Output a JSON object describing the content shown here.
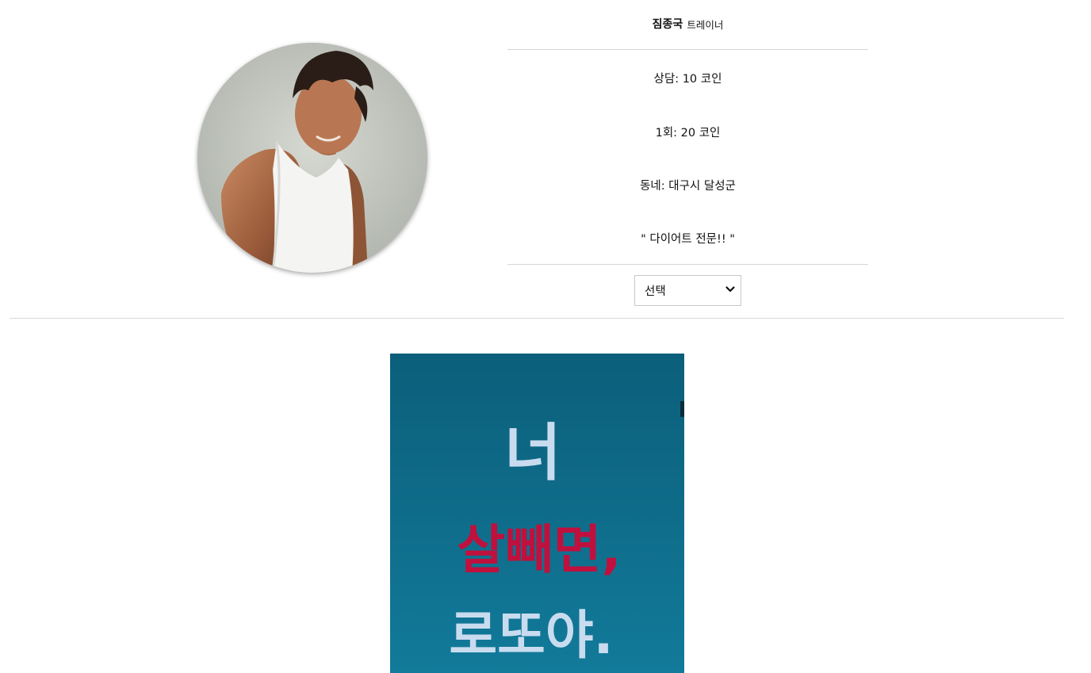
{
  "trainer": {
    "name": "짐종국",
    "role": "트레이너",
    "consult_price": "상담: 10 코인",
    "session_price": "1회: 20 코인",
    "neighborhood": "동네: 대구시 달성군",
    "tagline": "\" 다이어트 전문!! \""
  },
  "selector": {
    "selected_value": "선택"
  },
  "poster": {
    "line1": "너",
    "line2": "살빼면,",
    "line3": "로또야.",
    "colors": {
      "background": "#0f6f8e",
      "light_text": "#c9dcef",
      "red_text": "#c0103e"
    }
  }
}
